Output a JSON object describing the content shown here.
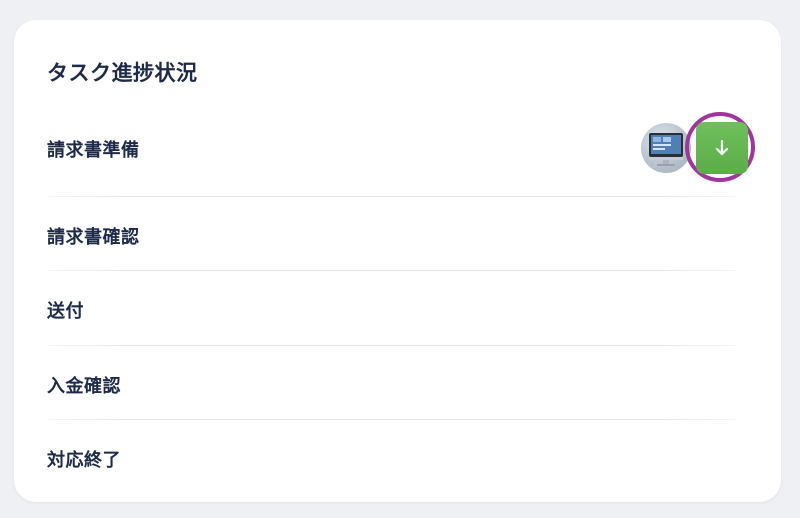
{
  "card": {
    "title": "タスク進捗状況",
    "tasks": [
      {
        "label": "請求書準備"
      },
      {
        "label": "請求書確認"
      },
      {
        "label": "送付"
      },
      {
        "label": "入金確認"
      },
      {
        "label": "対応終了"
      }
    ],
    "active_task": {
      "avatar_icon": "computer-monitor-icon",
      "action_icon": "arrow-down-icon",
      "action_color": "#6abb55",
      "highlight_color": "#a0359c"
    }
  }
}
